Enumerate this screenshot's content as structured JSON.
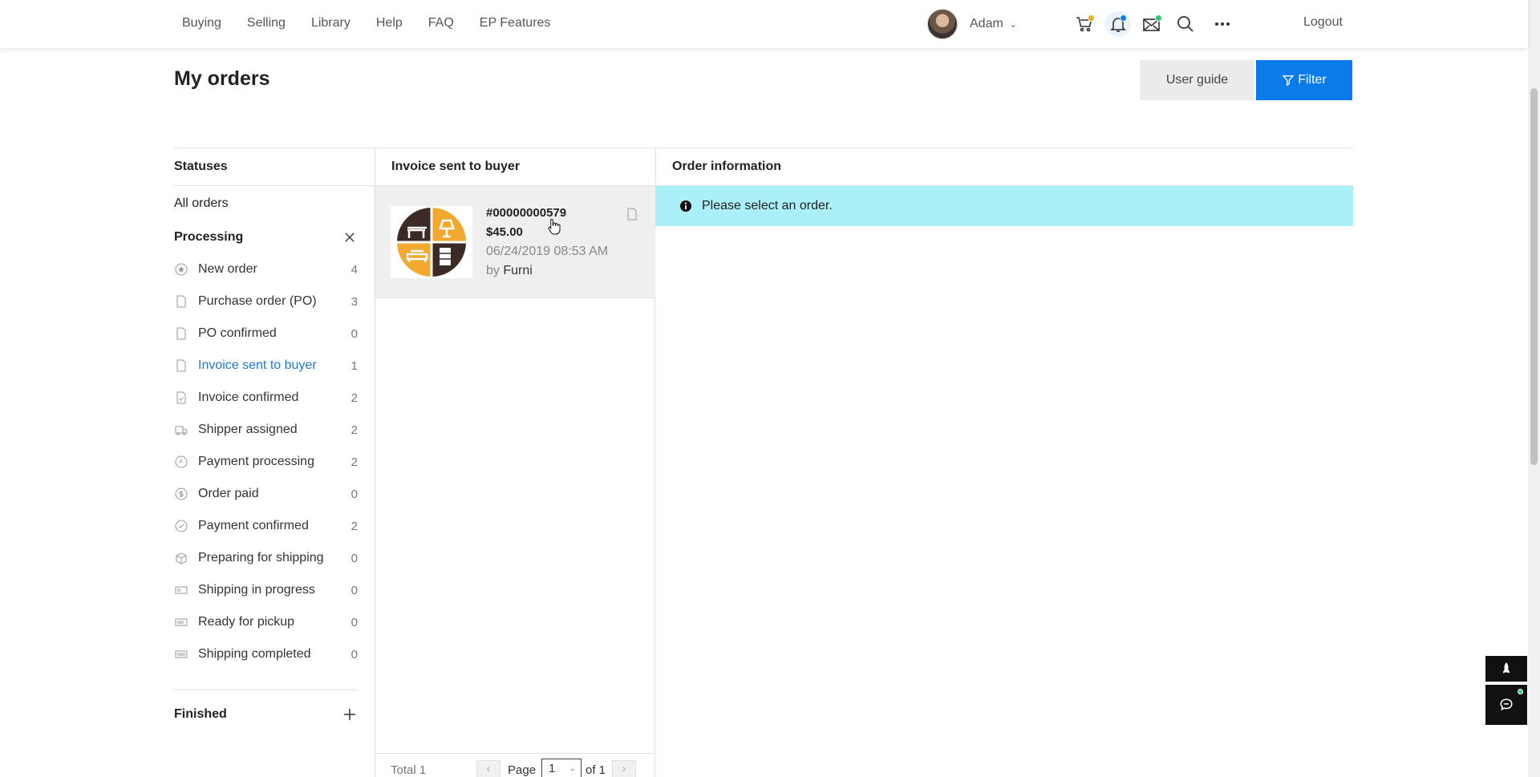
{
  "nav": {
    "links": [
      "Buying",
      "Selling",
      "Library",
      "Help",
      "FAQ",
      "EP Features"
    ],
    "user_name": "Adam",
    "logout_label": "Logout",
    "cart_badge_color": "#f5a623",
    "notifications_badge_color": "#0a7bea",
    "messages_badge_color": "#2ecc71"
  },
  "page": {
    "title": "My orders",
    "user_guide_label": "User guide",
    "filter_label": "Filter"
  },
  "statuses": {
    "heading": "Statuses",
    "all_orders_label": "All orders",
    "processing_label": "Processing",
    "finished_label": "Finished",
    "items": [
      {
        "label": "New order",
        "count": "4",
        "icon": "star-circle-icon"
      },
      {
        "label": "Purchase order (PO)",
        "count": "3",
        "icon": "document-icon"
      },
      {
        "label": "PO confirmed",
        "count": "0",
        "icon": "document-icon"
      },
      {
        "label": "Invoice sent to buyer",
        "count": "1",
        "icon": "document-icon",
        "active": true
      },
      {
        "label": "Invoice confirmed",
        "count": "2",
        "icon": "document-check-icon"
      },
      {
        "label": "Shipper assigned",
        "count": "2",
        "icon": "truck-icon"
      },
      {
        "label": "Payment processing",
        "count": "2",
        "icon": "clock-icon"
      },
      {
        "label": "Order paid",
        "count": "0",
        "icon": "dollar-circle-icon"
      },
      {
        "label": "Payment confirmed",
        "count": "2",
        "icon": "check-circle-icon"
      },
      {
        "label": "Preparing for shipping",
        "count": "0",
        "icon": "box-icon"
      },
      {
        "label": "Shipping in progress",
        "count": "0",
        "icon": "progress-bar-icon"
      },
      {
        "label": "Ready for pickup",
        "count": "0",
        "icon": "progress-bar-icon"
      },
      {
        "label": "Shipping completed",
        "count": "0",
        "icon": "progress-bar-icon"
      }
    ]
  },
  "orders_list": {
    "heading": "Invoice sent to buyer",
    "orders": [
      {
        "number": "#00000000579",
        "price": "$45.00",
        "date": "06/24/2019 08:53 AM",
        "by_label": "by",
        "seller": "Furni"
      }
    ],
    "pager": {
      "total": "Total 1",
      "page_label": "Page",
      "page": "1",
      "of": "of 1"
    }
  },
  "order_info": {
    "heading": "Order information",
    "message": "Please select an order."
  }
}
